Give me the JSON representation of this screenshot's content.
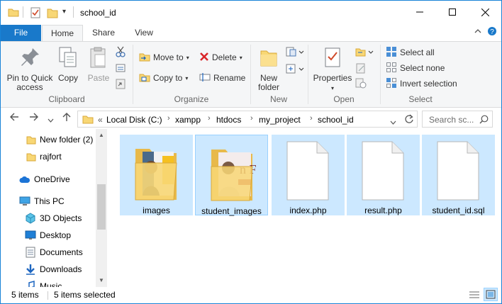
{
  "window": {
    "title": "school_id",
    "accent": "#1979ca",
    "selection_color": "#cce8ff"
  },
  "ribbon_tabs": {
    "file": "File",
    "home": "Home",
    "share": "Share",
    "view": "View"
  },
  "ribbon": {
    "clipboard": {
      "label": "Clipboard",
      "pin": "Pin to Quick access",
      "pin_line1": "Pin to Quick",
      "pin_line2": "access",
      "copy": "Copy",
      "paste": "Paste"
    },
    "organize": {
      "label": "Organize",
      "move_to": "Move to",
      "copy_to": "Copy to",
      "delete": "Delete",
      "rename": "Rename"
    },
    "new": {
      "label": "New",
      "new_folder_line1": "New",
      "new_folder_line2": "folder"
    },
    "open": {
      "label": "Open",
      "properties": "Properties"
    },
    "select": {
      "label": "Select",
      "select_all": "Select all",
      "select_none": "Select none",
      "invert": "Invert selection"
    }
  },
  "address": {
    "overflow": "«",
    "crumbs": [
      "Local Disk (C:)",
      "xampp",
      "htdocs",
      "my_project",
      "school_id"
    ],
    "search_placeholder": "Search sc..."
  },
  "nav_pane": {
    "items": [
      {
        "label": "New folder (2)",
        "icon": "folder-icon"
      },
      {
        "label": "rajfort",
        "icon": "folder-icon"
      },
      {
        "label": "OneDrive",
        "icon": "cloud-icon"
      },
      {
        "label": "This PC",
        "icon": "computer-icon"
      },
      {
        "label": "3D Objects",
        "icon": "cube-icon"
      },
      {
        "label": "Desktop",
        "icon": "desktop-icon"
      },
      {
        "label": "Documents",
        "icon": "document-icon"
      },
      {
        "label": "Downloads",
        "icon": "download-icon"
      },
      {
        "label": "Music",
        "icon": "music-icon"
      }
    ]
  },
  "files": [
    {
      "name": "images",
      "type": "folder"
    },
    {
      "name": "student_images",
      "type": "folder"
    },
    {
      "name": "index.php",
      "type": "file"
    },
    {
      "name": "result.php",
      "type": "file"
    },
    {
      "name": "student_id.sql",
      "type": "file"
    }
  ],
  "status": {
    "count": "5 items",
    "selected": "5 items selected"
  }
}
